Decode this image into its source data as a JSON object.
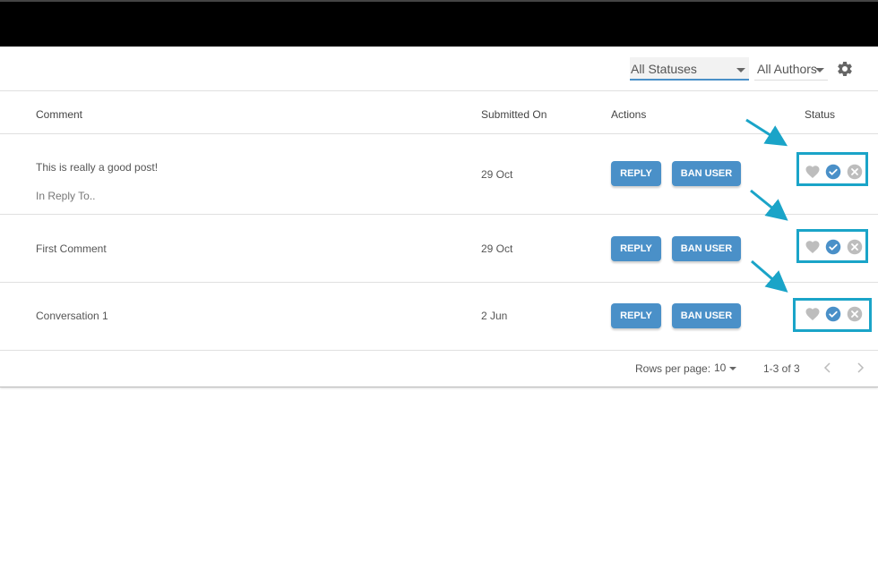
{
  "filters": {
    "status_value": "All Statuses",
    "author_value": "All Authors",
    "settings_icon": "gear-icon"
  },
  "table": {
    "headers": {
      "comment": "Comment",
      "submitted_on": "Submitted On",
      "actions": "Actions",
      "status": "Status"
    },
    "rows": [
      {
        "comment": "This is really a good post!",
        "reply_to": "In Reply To..",
        "date": "29 Oct",
        "reply_label": "REPLY",
        "ban_label": "BAN USER"
      },
      {
        "comment": "First Comment",
        "date": "29 Oct",
        "reply_label": "REPLY",
        "ban_label": "BAN USER"
      },
      {
        "comment": "Conversation 1",
        "date": "2 Jun",
        "reply_label": "REPLY",
        "ban_label": "BAN USER"
      }
    ],
    "status_icons": [
      "heart-icon",
      "check-circle-icon",
      "close-circle-icon"
    ]
  },
  "pagination": {
    "rows_per_page_label": "Rows per page:",
    "rows_per_page_value": "10",
    "range": "1-3 of 3"
  },
  "colors": {
    "accent": "#4a90c8",
    "annotation": "#1aa4c8",
    "icon_grey": "#bdbdbd"
  }
}
